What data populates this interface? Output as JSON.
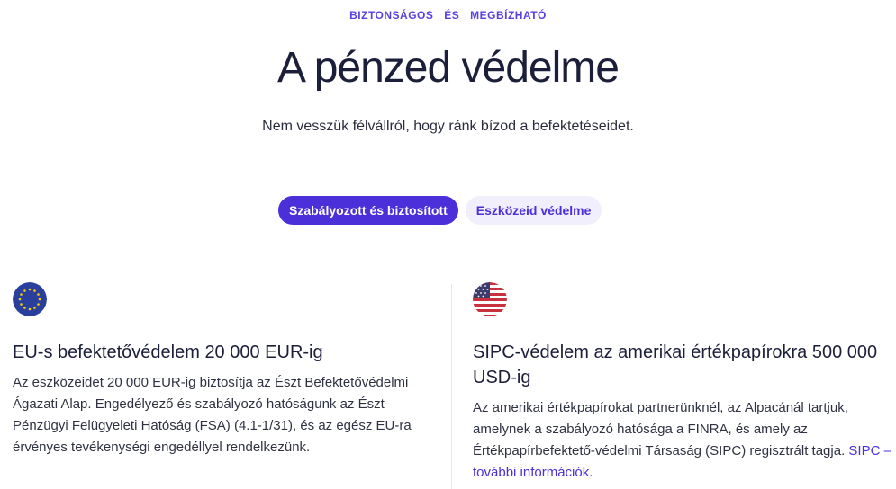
{
  "header": {
    "eyebrow_part1": "BIZTONSÁGOS",
    "eyebrow_part2": "ÉS",
    "eyebrow_part3": "MEGBÍZHATÓ",
    "title": "A pénzed védelme",
    "subtitle": "Nem vesszük félvállról, hogy ránk bízod a befektetéseidet."
  },
  "tabs": [
    {
      "label": "Szabályozott és biztosított",
      "active": true
    },
    {
      "label": "Eszközeid védelme",
      "active": false
    }
  ],
  "cards": [
    {
      "icon": "eu-flag-icon",
      "heading": "EU-s befektetővédelem 20 000 EUR-ig",
      "body": "Az eszközeidet 20 000 EUR-ig biztosítja az Észt Befektetővédelmi Ágazati Alap. Engedélyező és szabályozó hatóságunk az Észt Pénzügyi Felügyeleti Hatóság (FSA) (4.1-1/31), és az egész EU-ra érvényes tevékenységi engedéllyel rendelkezünk."
    },
    {
      "icon": "us-flag-icon",
      "heading": "SIPC-védelem az amerikai értékpapírokra 500 000 USD-ig",
      "body": "Az amerikai értékpapírokat partnerünknél, az Alpacánál tartjuk, amelynek a szabályozó hatósága a FINRA, és amely az Értékpapírbefektető-védelmi Társaság (SIPC) regisztrált tagja. ",
      "link": "SIPC – további információk",
      "link_suffix": "."
    }
  ],
  "colors": {
    "accent": "#4b2fd8",
    "accent_light": "#f2effd",
    "text": "#1c1f3a"
  }
}
